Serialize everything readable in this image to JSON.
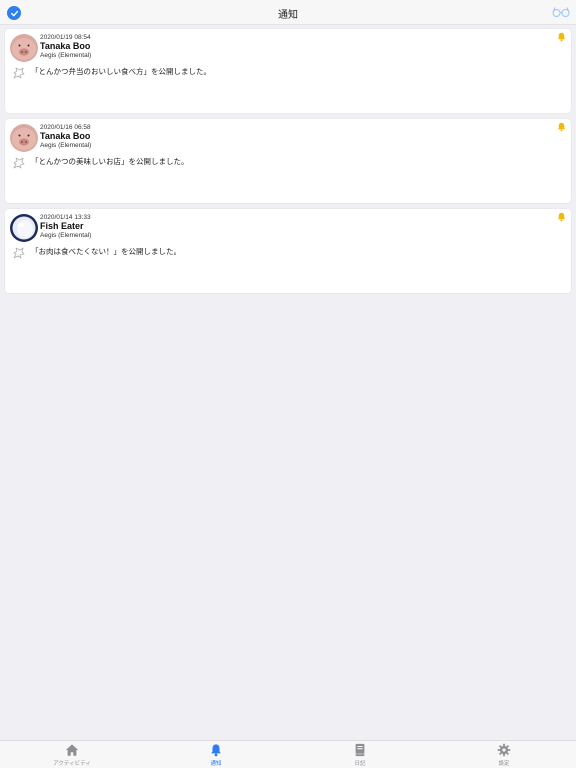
{
  "header": {
    "title": "通知"
  },
  "notifications": [
    {
      "date": "2020/01/19 08:54",
      "name": "Tanaka Boo",
      "group": "Aegis (Elemental)",
      "message": "「とんかつ弁当のおいしい食べ方」を公開しました。",
      "avatar": "pig-icon"
    },
    {
      "date": "2020/01/16 06:58",
      "name": "Tanaka Boo",
      "group": "Aegis (Elemental)",
      "message": "「とんかつの美味しいお店」を公開しました。",
      "avatar": "pig-icon"
    },
    {
      "date": "2020/01/14 13:33",
      "name": "Fish Eater",
      "group": "Aegis (Elemental)",
      "message": "「お肉は食べたくない！」を公開しました。",
      "avatar": "ghost-icon"
    }
  ],
  "tabs": [
    {
      "label": "アクティビティ",
      "icon": "home-icon",
      "active": false
    },
    {
      "label": "通知",
      "icon": "bell-icon",
      "active": true
    },
    {
      "label": "日記",
      "icon": "book-icon",
      "active": false
    },
    {
      "label": "設定",
      "icon": "gear-icon",
      "active": false
    }
  ],
  "colors": {
    "accent": "#2f7bf5",
    "bell": "#f5b800",
    "background": "#efeff4"
  }
}
